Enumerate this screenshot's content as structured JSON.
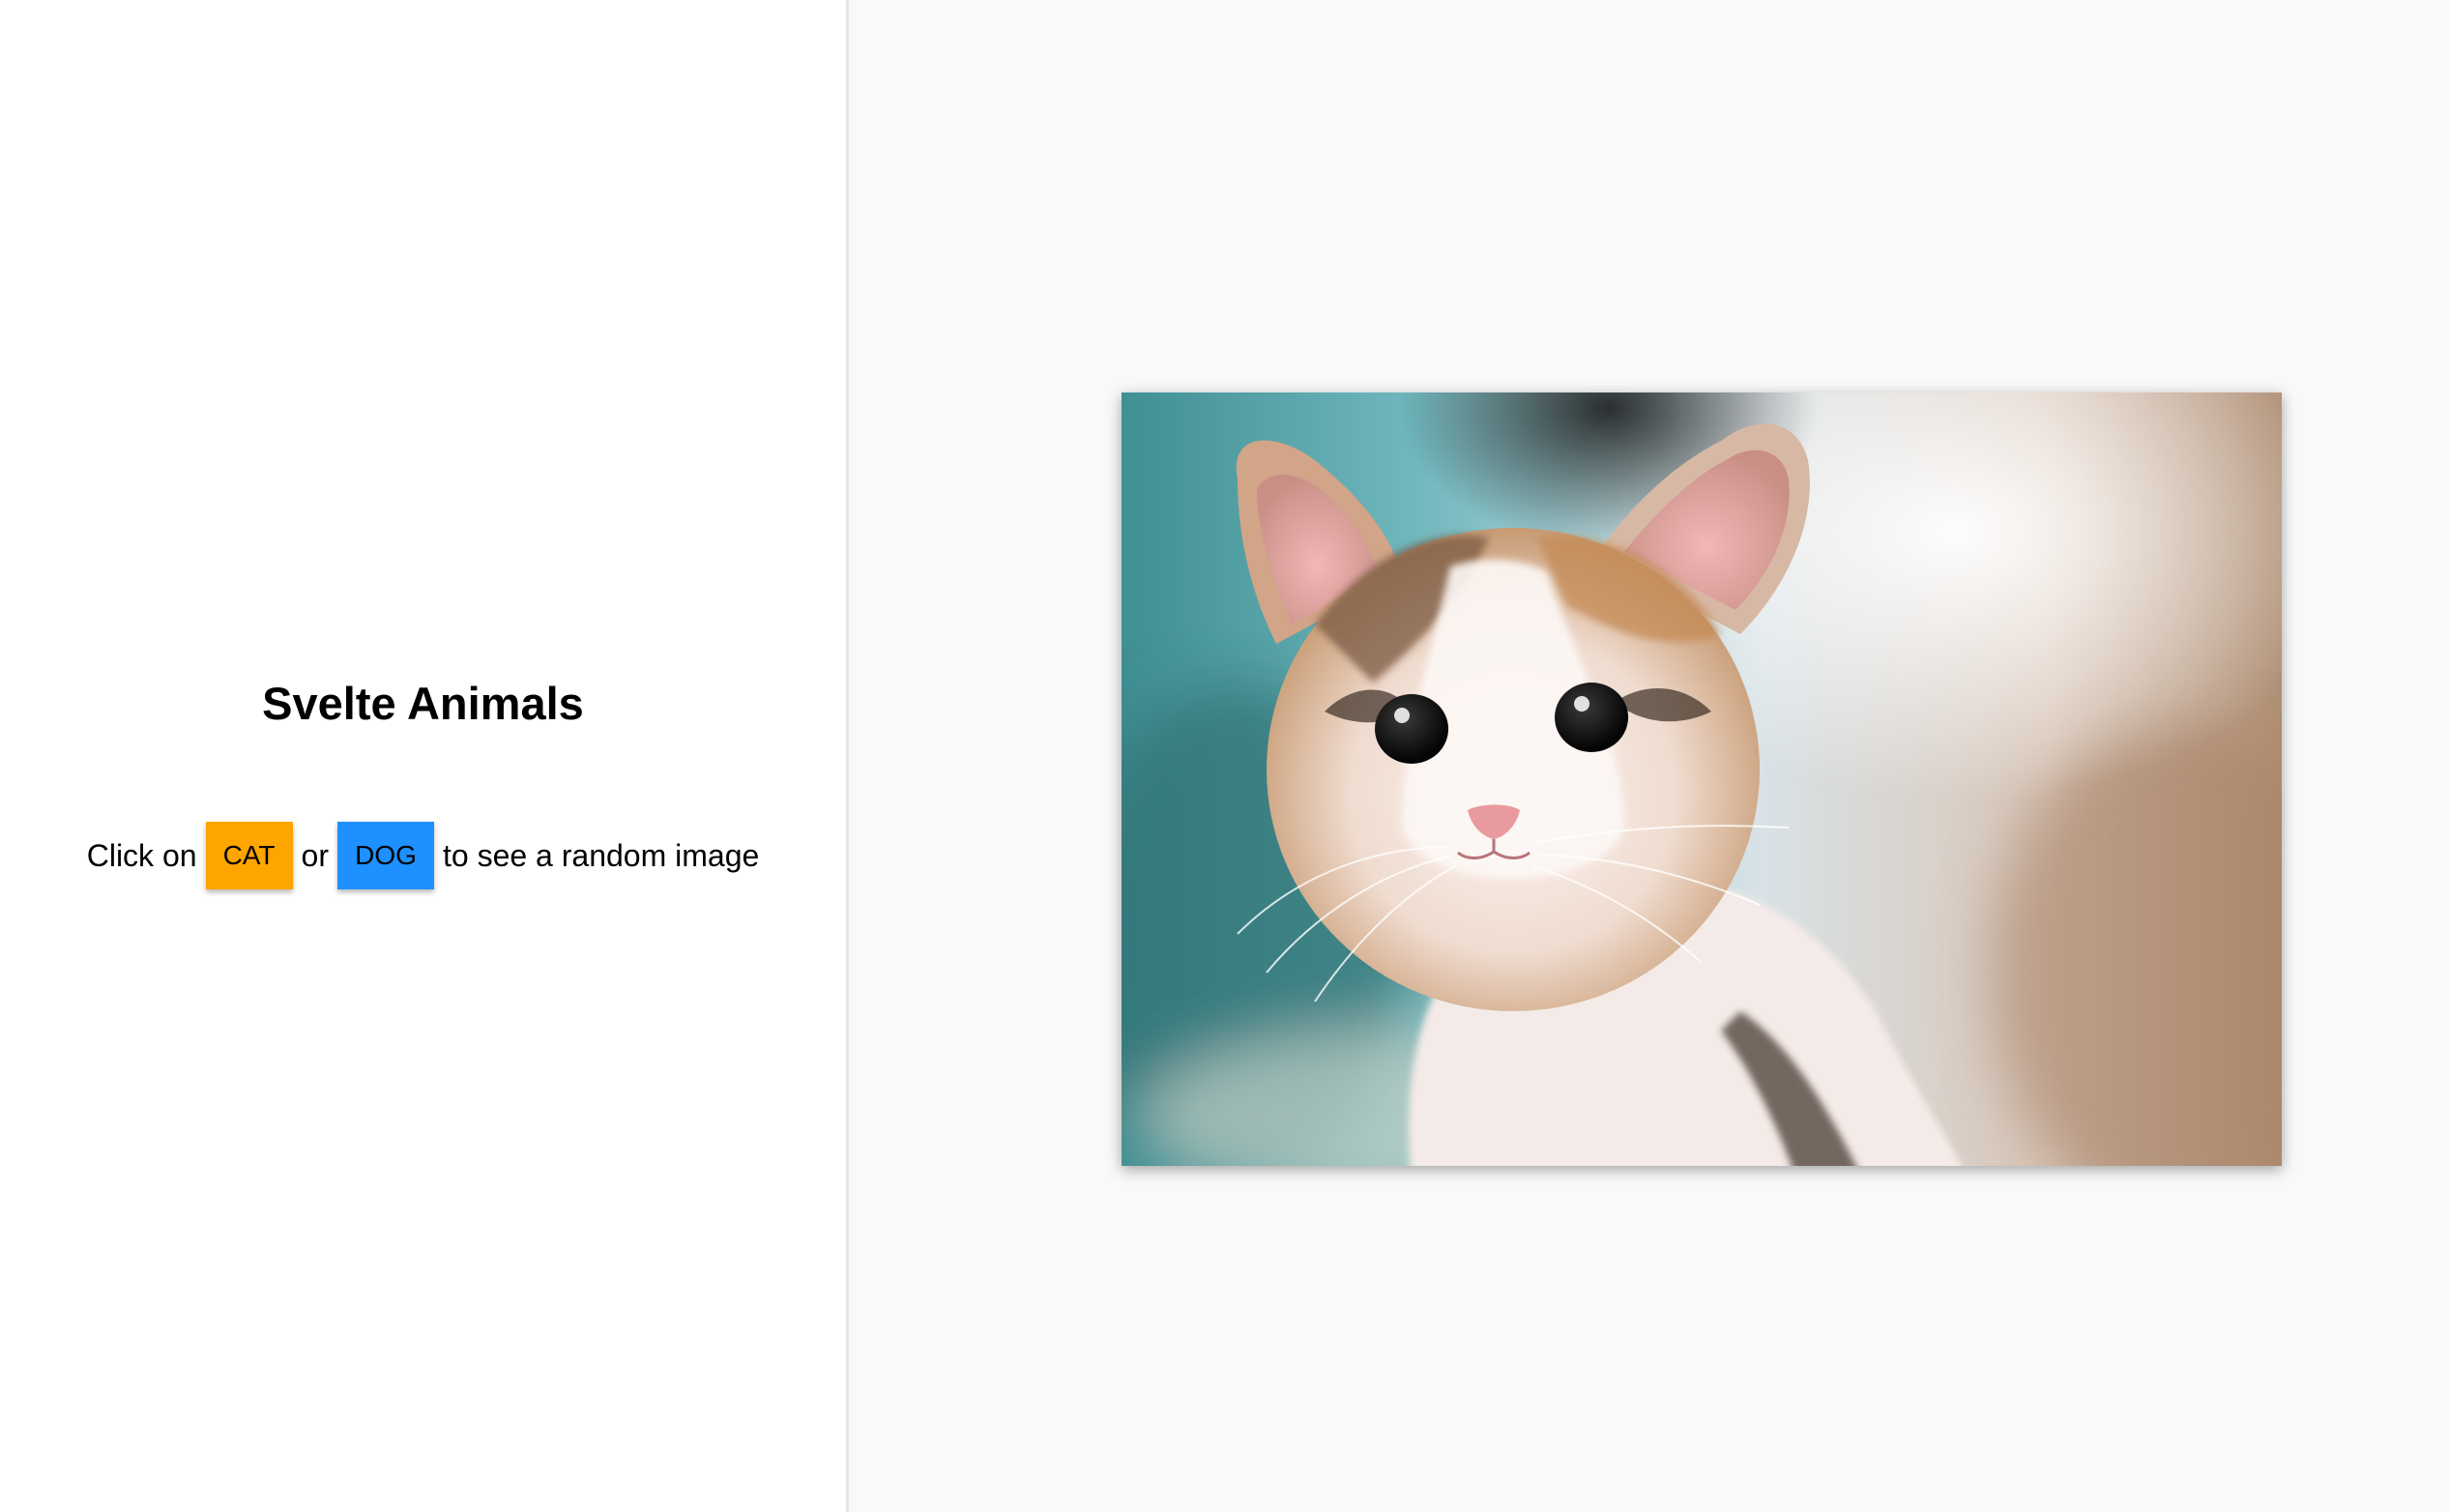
{
  "app": {
    "title": "Svelte Animals"
  },
  "instruction": {
    "prefix": "Click on",
    "middle": "or",
    "suffix": "to see a random image"
  },
  "buttons": {
    "cat": {
      "label": "CAT",
      "color": "#ffa500"
    },
    "dog": {
      "label": "DOG",
      "color": "#1e90ff"
    }
  },
  "image": {
    "subject": "kitten-photo"
  },
  "colors": {
    "left_bg": "#ffffff",
    "right_bg": "#f9f9f9",
    "divider": "#e6e6e6"
  }
}
